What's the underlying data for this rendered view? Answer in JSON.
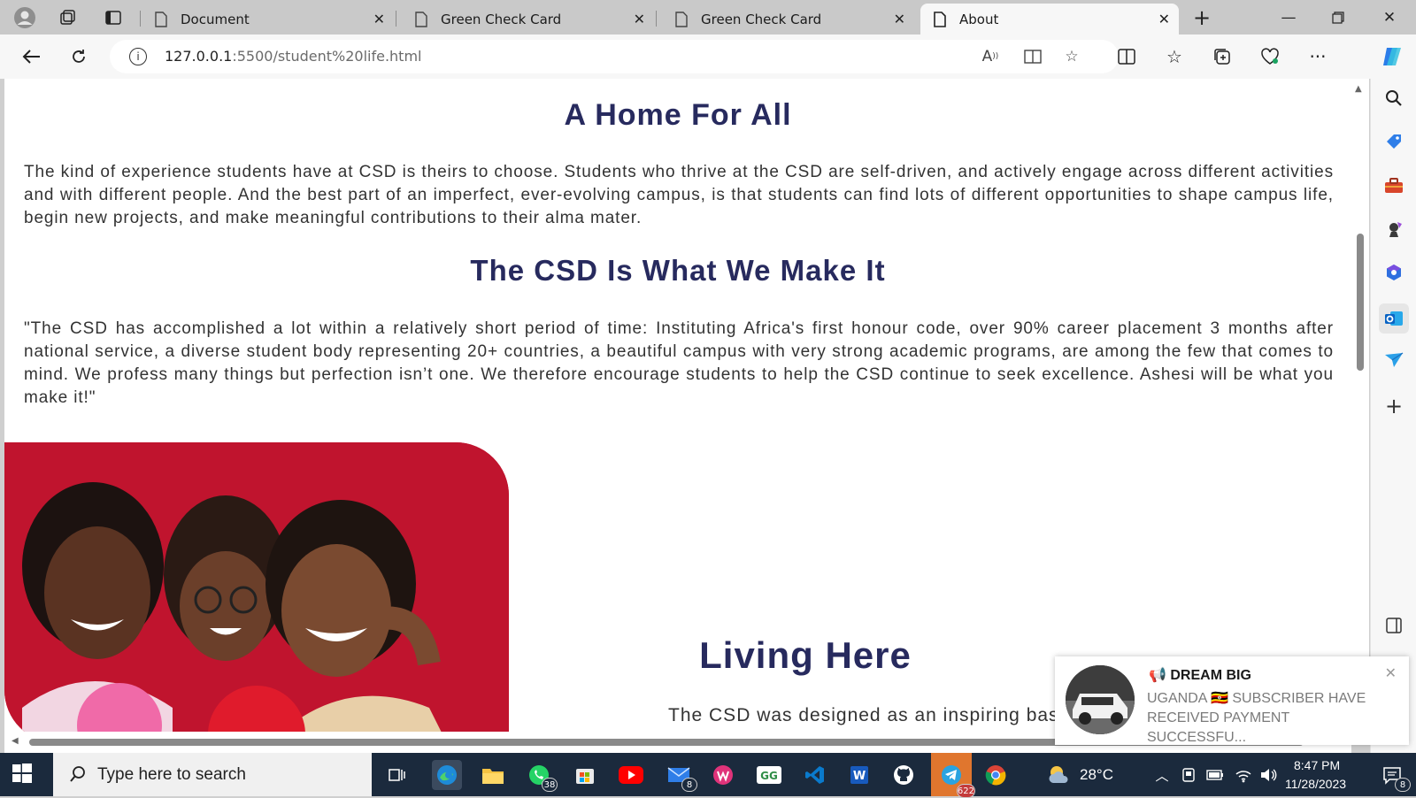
{
  "browser": {
    "tabs": [
      {
        "label": "Document",
        "active": false
      },
      {
        "label": "Green Check Card",
        "active": false
      },
      {
        "label": "Green Check Card",
        "active": false
      },
      {
        "label": "About",
        "active": true
      }
    ],
    "url_host": "127.0.0.1",
    "url_path": ":5500/student%20life.html"
  },
  "page": {
    "section1_title": "A Home For All",
    "section1_text": "The kind of experience students have at CSD is theirs to choose. Students who thrive at the CSD are self-driven, and actively engage across different activities and with different people. And the best part of an imperfect, ever-evolving campus, is that students can find lots of different opportunities to shape campus life, begin new projects, and make meaningful contributions to their alma mater.",
    "section2_title": "The CSD Is What We Make It",
    "section2_text": "\"The CSD has accomplished a lot within a relatively short period of time: Instituting Africa's first honour code, over 90% career placement 3 months after national service, a diverse student body representing 20+ countries, a beautiful campus with very strong academic programs, are among the few that comes to mind. We profess many things but perfection isn’t one. We therefore encourage students to help the CSD continue to seek excellence. Ashesi will be what you make it!\"",
    "section3_title": "Living Here",
    "section3_text": "The CSD was designed as an inspiring bas"
  },
  "notification": {
    "title": "📢 DREAM BIG",
    "body": "UGANDA 🇺🇬 SUBSCRIBER HAVE RECEIVED PAYMENT SUCCESSFU..."
  },
  "taskbar": {
    "search_placeholder": "Type here to search",
    "whatsapp_badge": "38",
    "mail_badge": "8",
    "telegram_badge": "622",
    "weather": "28°C",
    "time": "8:47 PM",
    "date": "11/28/2023",
    "notification_count": "8"
  },
  "colors": {
    "heading": "#272a5e",
    "photo_bg": "#c0142e",
    "taskbar": "#1b2a3d"
  }
}
